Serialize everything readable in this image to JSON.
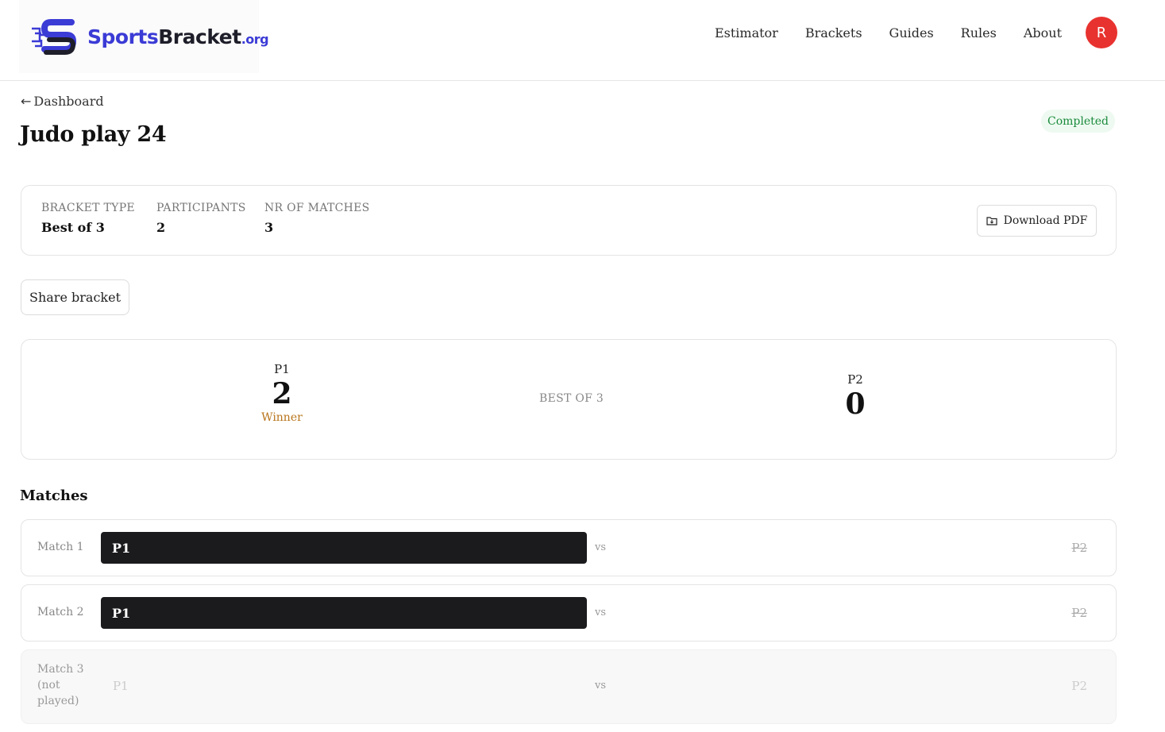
{
  "brand": {
    "logo_name": "sportsbracket-logo-icon",
    "name_part1": "Sports",
    "name_part2": "Bracket",
    "tld": ".org",
    "accent_color": "#3b3bd6"
  },
  "nav": {
    "items": [
      "Estimator",
      "Brackets",
      "Guides",
      "Rules",
      "About"
    ],
    "avatar_initial": "R",
    "avatar_color": "#e8322f"
  },
  "page": {
    "back_label": "Dashboard",
    "title": "Judo play 24",
    "status": "Completed",
    "status_color": "#1a8a3c"
  },
  "info": {
    "bracket_type_label": "BRACKET TYPE",
    "bracket_type_value": "Best of 3",
    "participants_label": "PARTICIPANTS",
    "participants_value": "2",
    "matches_label": "NR OF MATCHES",
    "matches_value": "3",
    "download_label": "Download PDF"
  },
  "share_label": "Share bracket",
  "scoreboard": {
    "p1_name": "P1",
    "p1_score": "2",
    "p1_tag": "Winner",
    "format": "BEST OF 3",
    "p2_name": "P2",
    "p2_score": "0"
  },
  "matches_title": "Matches",
  "matches": [
    {
      "label": "Match 1",
      "p1": "P1",
      "vs": "vs",
      "p2": "P2"
    },
    {
      "label": "Match 2",
      "p1": "P1",
      "vs": "vs",
      "p2": "P2"
    },
    {
      "label": "Match 3 (not played)",
      "p1": "P1",
      "vs": "vs",
      "p2": "P2"
    }
  ]
}
